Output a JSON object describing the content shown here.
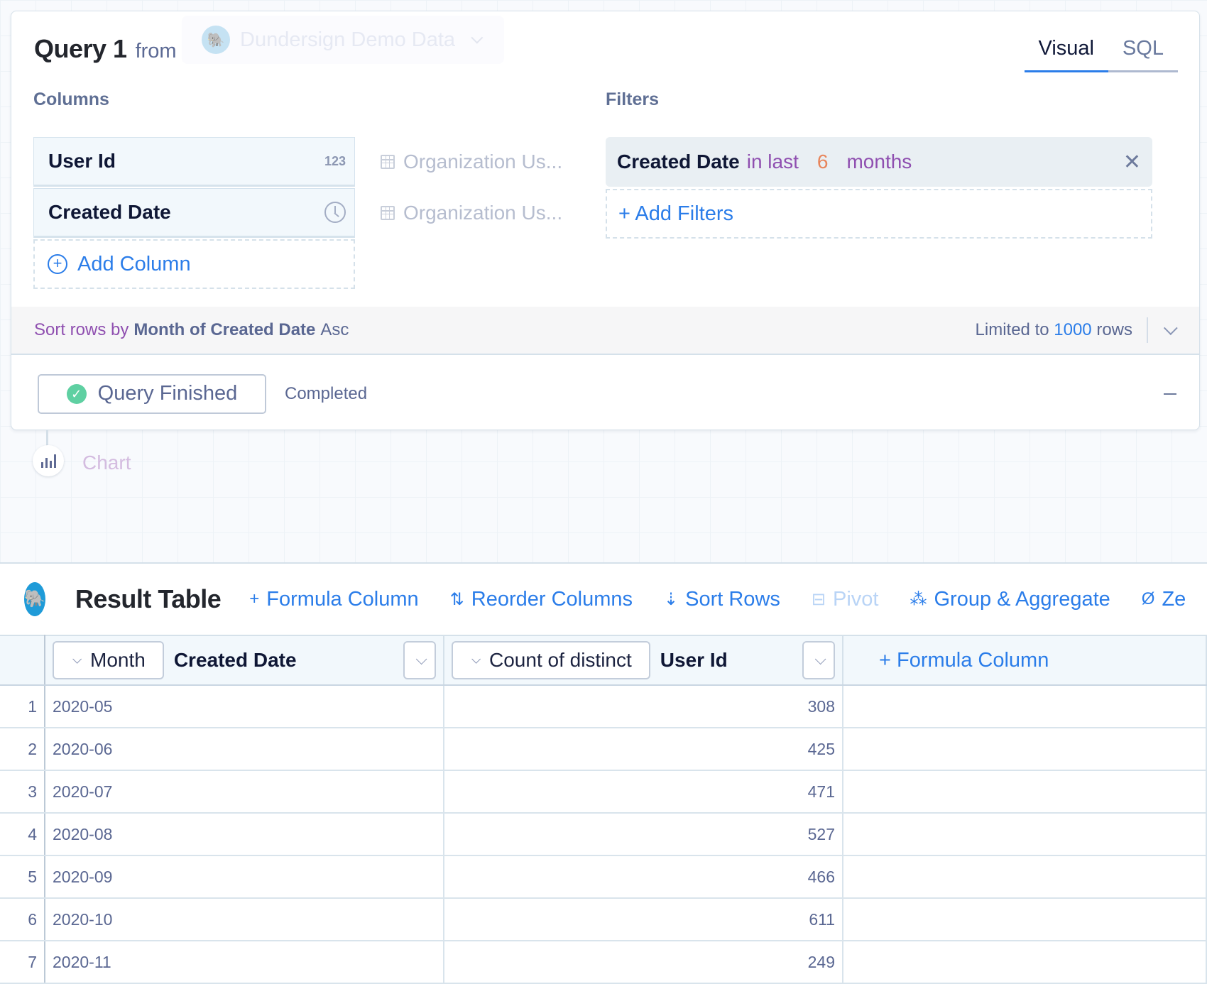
{
  "query": {
    "name": "Query 1",
    "from_label": "from",
    "source": "Dundersign Demo Data",
    "tabs": [
      {
        "label": "Visual",
        "active": true
      },
      {
        "label": "SQL",
        "active": false
      }
    ],
    "columns_label": "Columns",
    "columns": [
      {
        "label": "User Id",
        "type_badge": "123",
        "source": "Organization Us..."
      },
      {
        "label": "Created Date",
        "type_badge": "clock-icon",
        "source": "Organization Us..."
      }
    ],
    "add_column_label": "Add Column",
    "filters_label": "Filters",
    "filters": [
      {
        "field": "Created Date",
        "operator": "in last",
        "value": "6",
        "unit": "months"
      }
    ],
    "add_filters_label": "+ Add Filters",
    "sort": {
      "prefix": "Sort rows by",
      "field": "Month of Created Date",
      "direction": "Asc"
    },
    "limit": {
      "prefix": "Limited to",
      "value": "1000",
      "suffix": "rows"
    },
    "status": {
      "button_label": "Query Finished",
      "text": "Completed",
      "color": "#5fd0a2"
    }
  },
  "chart_step": {
    "label": "Chart"
  },
  "result": {
    "title": "Result Table",
    "toolbar": [
      {
        "icon": "plus-icon",
        "glyph": "+",
        "label": "Formula Column",
        "enabled": true
      },
      {
        "icon": "reorder-icon",
        "glyph": "⇅",
        "label": "Reorder Columns",
        "enabled": true
      },
      {
        "icon": "sort-icon",
        "glyph": "⇣",
        "label": "Sort Rows",
        "enabled": true
      },
      {
        "icon": "pivot-icon",
        "glyph": "⊟",
        "label": "Pivot",
        "enabled": false
      },
      {
        "icon": "group-icon",
        "glyph": "⁂",
        "label": "Group & Aggregate",
        "enabled": true
      },
      {
        "icon": "zero-fill-icon",
        "glyph": "Ø",
        "label": "Ze",
        "enabled": true
      }
    ],
    "columns": [
      {
        "aggregation": "Month",
        "name": "Created Date"
      },
      {
        "aggregation": "Count of distinct",
        "name": "User Id"
      }
    ],
    "add_formula_label": "+ Formula Column",
    "rows": [
      {
        "index": "1",
        "month": "2020-05",
        "count": "308"
      },
      {
        "index": "2",
        "month": "2020-06",
        "count": "425"
      },
      {
        "index": "3",
        "month": "2020-07",
        "count": "471"
      },
      {
        "index": "4",
        "month": "2020-08",
        "count": "527"
      },
      {
        "index": "5",
        "month": "2020-09",
        "count": "466"
      },
      {
        "index": "6",
        "month": "2020-10",
        "count": "611"
      },
      {
        "index": "7",
        "month": "2020-11",
        "count": "249"
      }
    ]
  },
  "colors": {
    "accent": "#2b7de9",
    "operator": "#8f4fb0",
    "value": "#e8855b",
    "postgres": "#1f9bd8"
  }
}
